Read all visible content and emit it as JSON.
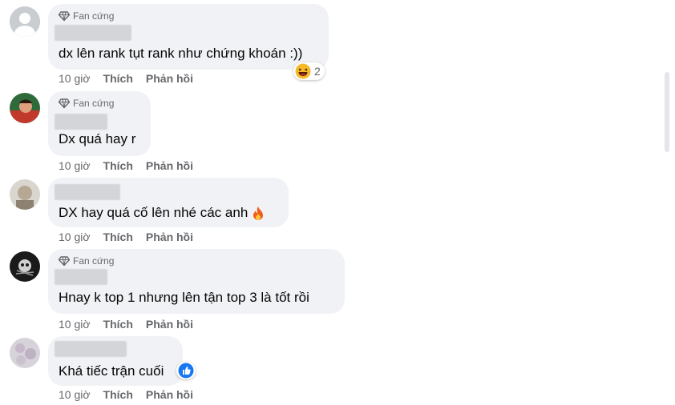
{
  "comments": [
    {
      "badge": "Fan cứng",
      "text": "dx lên rank tụt rank như chứng khoán :))",
      "time": "10 giờ",
      "like": "Thích",
      "reply": "Phản hồi",
      "reaction_count": "2"
    },
    {
      "badge": "Fan cứng",
      "text": "Dx quá hay r",
      "time": "10 giờ",
      "like": "Thích",
      "reply": "Phản hồi"
    },
    {
      "text": "DX hay quá cố lên nhé các anh",
      "time": "10 giờ",
      "like": "Thích",
      "reply": "Phản hồi"
    },
    {
      "badge": "Fan cứng",
      "text": "Hnay k top 1 nhưng lên tận top 3 là tốt rồi",
      "time": "10 giờ",
      "like": "Thích",
      "reply": "Phản hồi"
    },
    {
      "text": "Khá tiếc trận cuối",
      "time": "10 giờ",
      "like": "Thích",
      "reply": "Phản hồi"
    }
  ],
  "icons": {
    "badge": "diamond-icon",
    "reaction": "laughing-emoji-icon",
    "fire": "fire-emoji-icon",
    "like": "thumbs-up-icon"
  },
  "colors": {
    "bubble": "#f0f2f5",
    "meta": "#65676b",
    "like_blue": "#1877f2"
  }
}
